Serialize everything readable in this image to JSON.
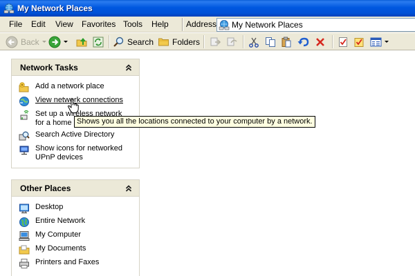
{
  "window": {
    "title": "My Network Places",
    "icon": "network-places-icon"
  },
  "menubar": {
    "items": [
      "File",
      "Edit",
      "View",
      "Favorites",
      "Tools",
      "Help"
    ],
    "address_label": "Address",
    "address_value": "My Network Places"
  },
  "toolbar": {
    "back_label": "Back",
    "search_label": "Search",
    "folders_label": "Folders"
  },
  "network_tasks": {
    "title": "Network Tasks",
    "items": [
      {
        "label": "Add a network place",
        "icon": "add-network-place-icon"
      },
      {
        "label": "View network connections",
        "icon": "network-connections-icon"
      },
      {
        "label": "Set up a wireless network\nfor a home",
        "icon": "wireless-network-icon"
      },
      {
        "label": "Search Active Directory",
        "icon": "search-directory-icon"
      },
      {
        "label": "Show icons for networked\nUPnP devices",
        "icon": "upnp-devices-icon"
      }
    ]
  },
  "other_places": {
    "title": "Other Places",
    "items": [
      {
        "label": "Desktop",
        "icon": "desktop-icon"
      },
      {
        "label": "Entire Network",
        "icon": "globe-icon"
      },
      {
        "label": "My Computer",
        "icon": "computer-icon"
      },
      {
        "label": "My Documents",
        "icon": "folder-icon"
      },
      {
        "label": "Printers and Faxes",
        "icon": "printer-icon"
      }
    ]
  },
  "tooltip": {
    "text": "Shows you all the locations connected to your computer by a network."
  },
  "colors": {
    "titlebar": "#0058e0",
    "chrome": "#ece9d8",
    "tooltip_bg": "#ffffe1"
  }
}
